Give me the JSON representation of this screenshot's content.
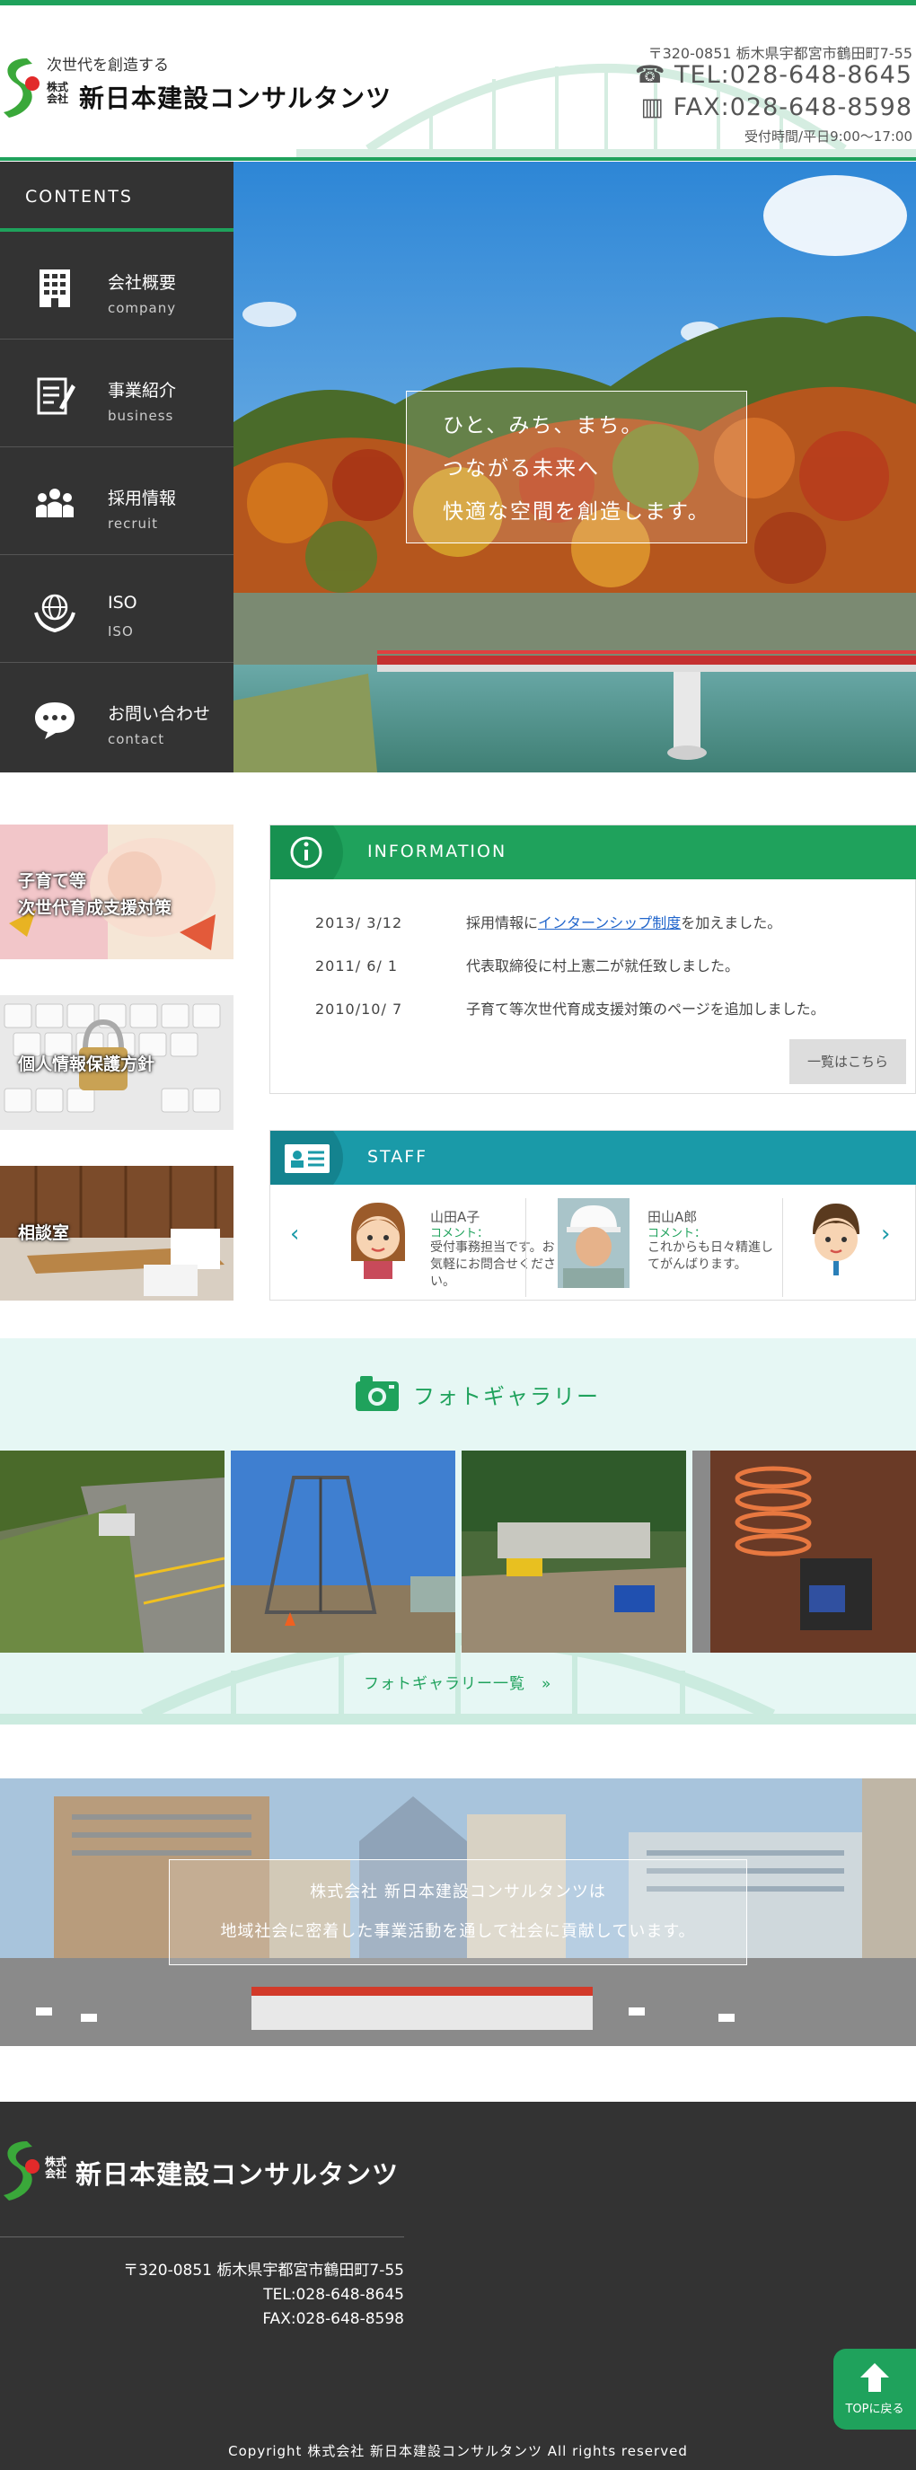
{
  "header": {
    "tagline": "次世代を創造する",
    "company_prefix": "株式会社",
    "company_name": "新日本建設コンサルタンツ",
    "address": "〒320-0851 栃木県宇都宮市鶴田町7-55",
    "tel": "TEL:028-648-8645",
    "fax": "FAX:028-648-8598",
    "hours": "受付時間/平日9:00〜17:00"
  },
  "sidebar": {
    "heading": "CONTENTS",
    "items": [
      {
        "label": "会社概要",
        "sub": "company",
        "icon": "building-icon"
      },
      {
        "label": "事業紹介",
        "sub": "business",
        "icon": "document-icon"
      },
      {
        "label": "採用情報",
        "sub": "recruit",
        "icon": "people-icon"
      },
      {
        "label": "ISO",
        "sub": "ISO",
        "icon": "globe-hands-icon"
      },
      {
        "label": "お問い合わせ",
        "sub": "contact",
        "icon": "chat-icon"
      }
    ]
  },
  "hero": {
    "line1": "ひと、みち、まち。",
    "line2": "つながる未来へ",
    "line3": "快適な空間を創造します。"
  },
  "banners": [
    {
      "line1": "子育て等",
      "line2": "次世代育成支援対策"
    },
    {
      "line1": "個人情報保護方針"
    },
    {
      "line1": "相談室"
    }
  ],
  "information": {
    "title": "INFORMATION",
    "rows": [
      {
        "date": "2013/ 3/12",
        "pre": "採用情報に",
        "link": "インターンシップ制度",
        "post": "を加えました。"
      },
      {
        "date": "2011/ 6/ 1",
        "pre": "代表取締役に村上憲二が就任致しました。",
        "link": "",
        "post": ""
      },
      {
        "date": "2010/10/ 7",
        "pre": "子育て等次世代育成支援対策のページを追加しました。",
        "link": "",
        "post": ""
      }
    ],
    "more": "一覧はこちら"
  },
  "staff": {
    "title": "STAFF",
    "comment_label": "コメント：",
    "members": [
      {
        "name": "山田A子",
        "comment": "受付事務担当です。お気軽にお問合せください。"
      },
      {
        "name": "田山A郎",
        "comment": "これからも日々精進してがんばります。"
      }
    ],
    "prev": "‹",
    "next": "›"
  },
  "gallery": {
    "title": "フォトギャラリー",
    "more": "フォトギャラリー一覧　»"
  },
  "city": {
    "line1": "株式会社 新日本建設コンサルタンツは",
    "line2": "地域社会に密着した事業活動を通して社会に貢献しています。"
  },
  "footer": {
    "company_prefix": "株式会社",
    "company_name": "新日本建設コンサルタンツ",
    "address": "〒320-0851 栃木県宇都宮市鶴田町7-55",
    "tel": "TEL:028-648-8645",
    "fax": "FAX:028-648-8598",
    "copyright": "Copyright 株式会社 新日本建設コンサルタンツ All rights reserved",
    "top_button": "TOPに戻る"
  },
  "colors": {
    "brand_green": "#1fa25c",
    "staff_teal": "#1a9aa8",
    "sidebar_dark": "#333333"
  }
}
